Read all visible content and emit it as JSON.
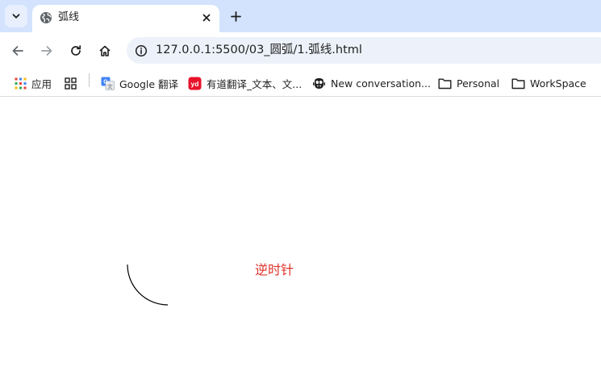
{
  "tab": {
    "title": "弧线",
    "favicon": "globe-icon"
  },
  "toolbar": {
    "url": "127.0.0.1:5500/03_圆弧/1.弧线.html",
    "icons": [
      "back-arrow-icon",
      "forward-arrow-icon",
      "reload-icon",
      "home-icon",
      "info-icon"
    ]
  },
  "bookmarks": {
    "apps_label": "应用",
    "items": [
      {
        "label": "Google 翻译",
        "icon": "google-translate-icon"
      },
      {
        "label": "有道翻译_文本、文...",
        "icon": "youdao-icon"
      },
      {
        "label": "New conversation...",
        "icon": "copilot-icon"
      },
      {
        "label": "Personal",
        "icon": "folder-icon"
      },
      {
        "label": "WorkSpace",
        "icon": "folder-icon"
      }
    ]
  },
  "page": {
    "label": "逆时针",
    "label_color": "#e0342b",
    "arc": {
      "start_angle_deg": 180,
      "end_angle_deg": 90,
      "direction": "counterclockwise",
      "stroke_color": "#000000"
    }
  },
  "colors": {
    "tabstrip": "#d3e3fd",
    "omnibox": "#edf2fa"
  }
}
